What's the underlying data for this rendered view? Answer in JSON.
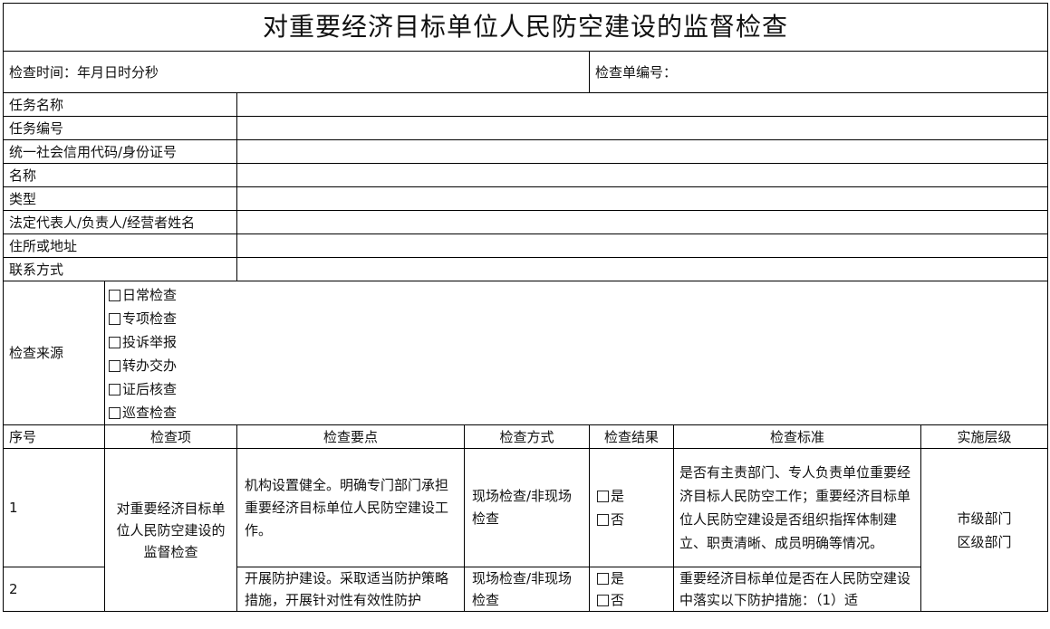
{
  "title": "对重要经济目标单位人民防空建设的监督检查",
  "check_time_label": "检查时间：年月日时分秒",
  "check_number_label": "检查单编号：",
  "info_fields": [
    {
      "label": "任务名称"
    },
    {
      "label": "任务编号"
    },
    {
      "label": "统一社会信用代码/身份证号"
    },
    {
      "label": "名称"
    },
    {
      "label": "类型"
    },
    {
      "label": "法定代表人/负责人/经营者姓名"
    },
    {
      "label": "住所或地址"
    },
    {
      "label": "联系方式"
    }
  ],
  "source": {
    "label": "检查来源",
    "options": [
      "日常检查",
      "专项检查",
      "投诉举报",
      "转办交办",
      "证后核查",
      "巡查检查"
    ]
  },
  "table_headers": [
    "序号",
    "检查项",
    "检查要点",
    "检查方式",
    "检查结果",
    "检查标准",
    "实施层级"
  ],
  "rows": [
    {
      "index": "1",
      "item": "对重要经济目标单位人民防空建设的监督检查",
      "point": "机构设置健全。明确专门部门承担重要经济目标单位人民防空建设工作。",
      "method": "现场检查/非现场检查",
      "result_yes": "是",
      "result_no": "否",
      "standard": "是否有主责部门、专人负责单位重要经济目标人民防空工作；重要经济目标单位人民防空建设是否组织指挥体制建立、职责清晰、成员明确等情况。",
      "level": "市级部门\n区级部门"
    },
    {
      "index": "2",
      "point": "开展防护建设。采取适当防护策略措施，开展针对性有效性防护",
      "method": "现场检查/非现场检查",
      "result_yes": "是",
      "result_no": "否",
      "standard": "重要经济目标单位是否在人民防空建设中落实以下防护措施：（1）适"
    }
  ]
}
